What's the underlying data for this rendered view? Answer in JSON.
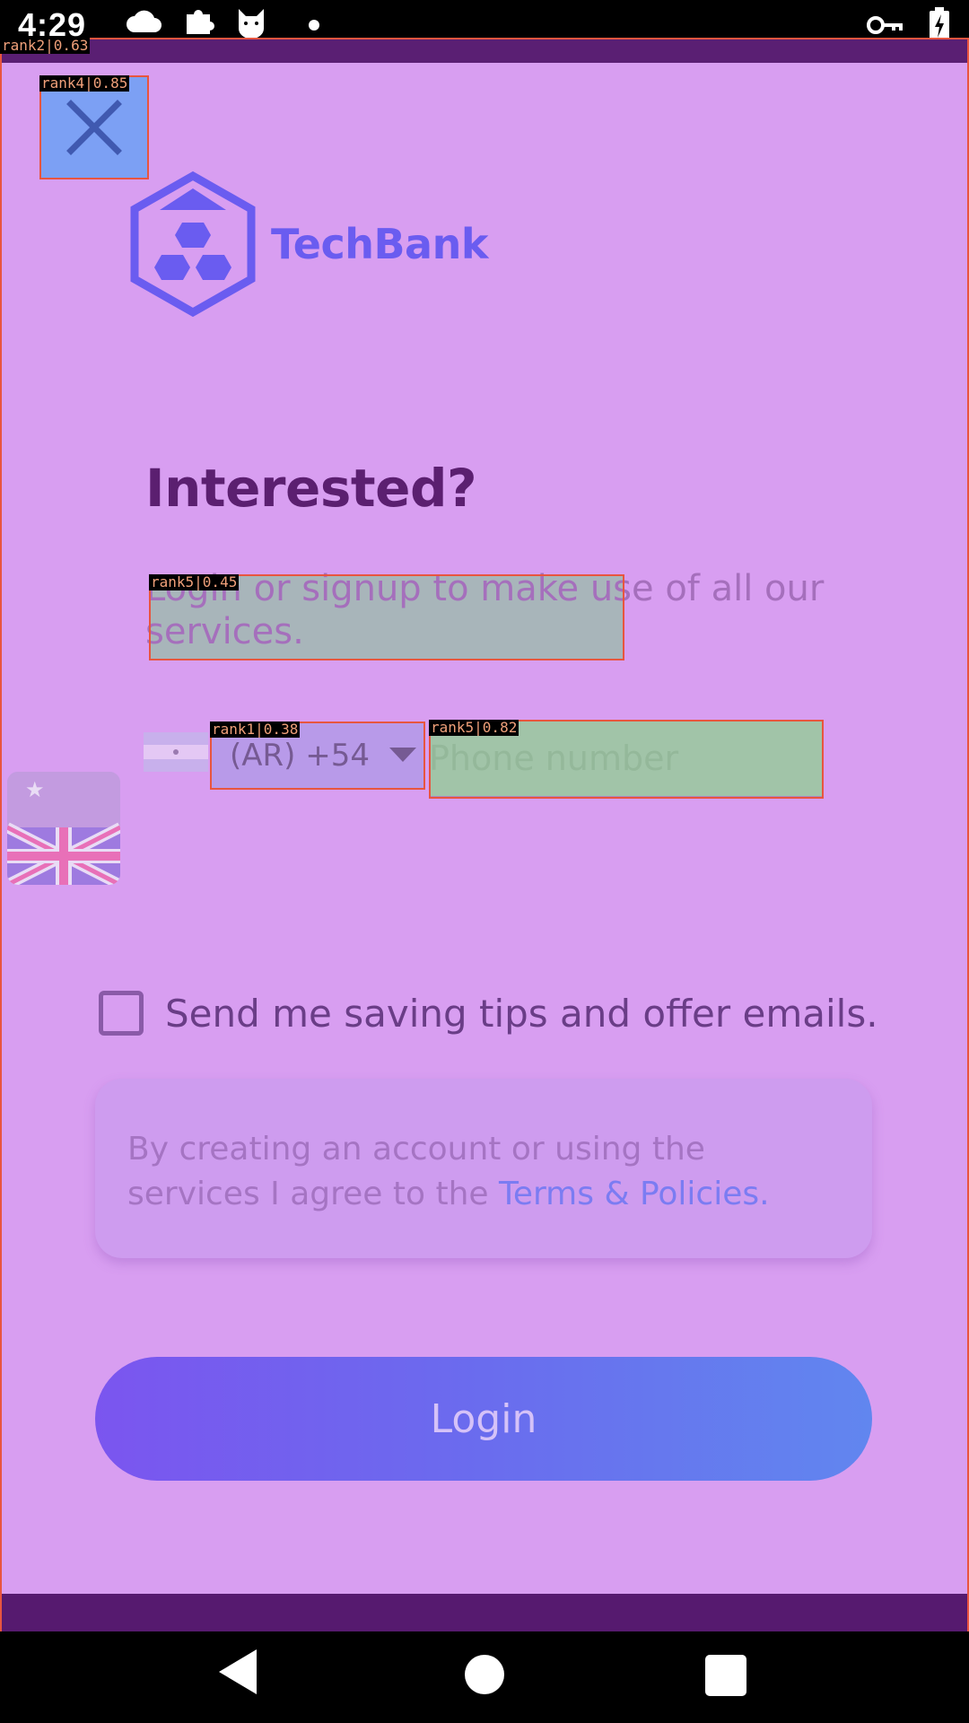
{
  "status_bar": {
    "time": "4:29",
    "left_icons": [
      "cloud-icon",
      "puzzle-icon",
      "cat-icon",
      "dot-icon"
    ],
    "right_icons": [
      "vpn-key-icon",
      "battery-charging-icon"
    ]
  },
  "close_button": {
    "icon": "close-icon"
  },
  "logo": {
    "text": "TechBank"
  },
  "headline": "Interested?",
  "subtext": "Login or signup to  make use of all our services.",
  "phone": {
    "country_code": "(AR) +54",
    "placeholder": "Phone number"
  },
  "checkbox": {
    "label": "Send me saving tips and offer emails.",
    "checked": false
  },
  "terms": {
    "prefix": "By creating an account or using the services I agree to the ",
    "link": "Terms & Policies."
  },
  "login_button": {
    "label": "Login"
  },
  "overlays": [
    {
      "label": "rank2|0.63"
    },
    {
      "label": "rank4|0.85"
    },
    {
      "label": "rank5|0.45"
    },
    {
      "label": "rank1|0.38"
    },
    {
      "label": "rank5|0.82"
    }
  ],
  "colors": {
    "background": "#d89ef1",
    "top_bar": "#5a1f73",
    "accent": "#6a5cf0",
    "headline": "#5b1f70",
    "link": "#7b7cf2",
    "overlay_border": "#e8553f"
  }
}
